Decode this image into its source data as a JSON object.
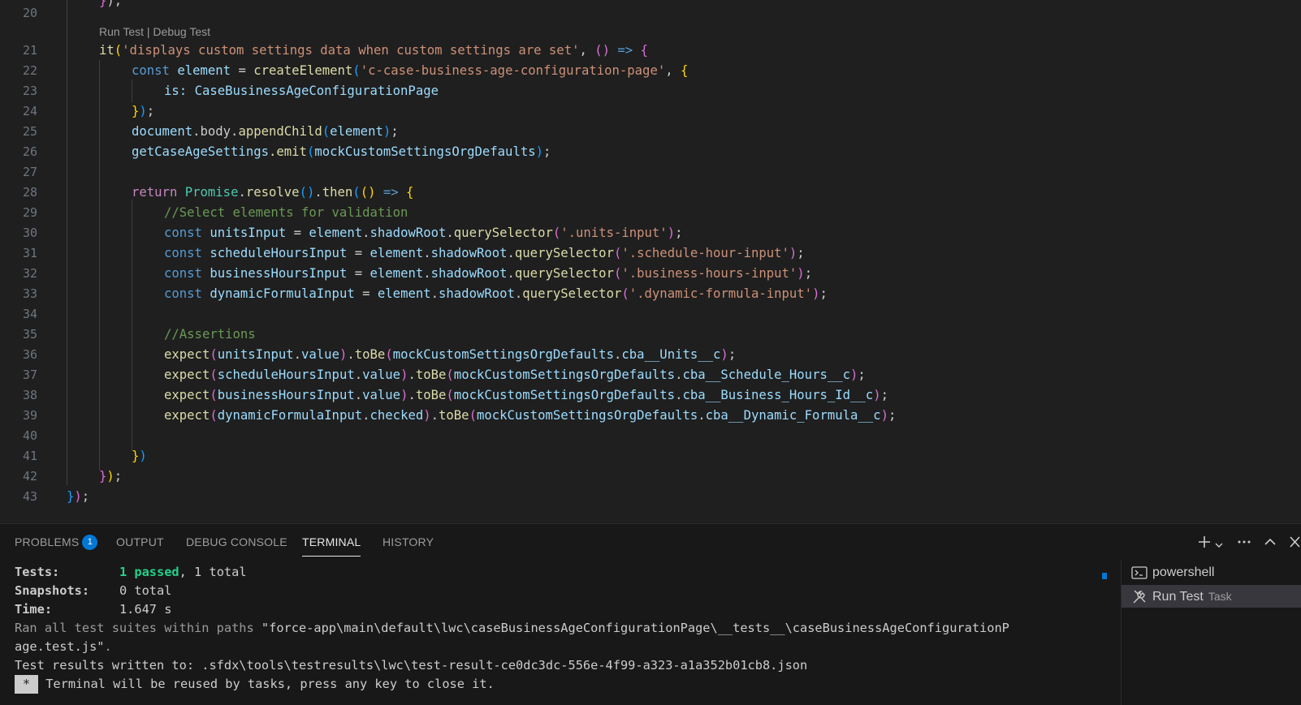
{
  "editor": {
    "codelens": {
      "run": "Run Test",
      "sep": " | ",
      "debug": "Debug Test"
    },
    "lines": [
      {
        "n": "20"
      },
      {
        "n": "21"
      },
      {
        "n": "22"
      },
      {
        "n": "23"
      },
      {
        "n": "24"
      },
      {
        "n": "25"
      },
      {
        "n": "26"
      },
      {
        "n": "27"
      },
      {
        "n": "28"
      },
      {
        "n": "29"
      },
      {
        "n": "30"
      },
      {
        "n": "31"
      },
      {
        "n": "32"
      },
      {
        "n": "33"
      },
      {
        "n": "34"
      },
      {
        "n": "35"
      },
      {
        "n": "36"
      },
      {
        "n": "37"
      },
      {
        "n": "38"
      },
      {
        "n": "39"
      },
      {
        "n": "40"
      },
      {
        "n": "41"
      },
      {
        "n": "42"
      },
      {
        "n": "43"
      }
    ],
    "code": {
      "l21_it": "it",
      "l21_str": "'displays custom settings data when custom settings are set'",
      "l22_const": "const",
      "l22_var": "element",
      "l22_fn": "createElement",
      "l22_str": "'c-case-business-age-configuration-page'",
      "l23_is": "is: ",
      "l23_cls": "CaseBusinessAgeConfigurationPage",
      "l25_a": "document",
      "l25_b": ".body.",
      "l25_fn": "appendChild",
      "l25_arg": "element",
      "l26_a": "getCaseAgeSettings",
      "l26_fn": ".emit",
      "l26_arg": "mockCustomSettingsOrgDefaults",
      "l28_ret": "return",
      "l28_cls": "Promise",
      "l28_fn1": "resolve",
      "l28_fn2": "then",
      "l29_cm": "//Select elements for validation",
      "l30_var": "unitsInput",
      "l30_str": "'.units-input'",
      "l31_var": "scheduleHoursInput",
      "l31_str": "'.schedule-hour-input'",
      "l32_var": "businessHoursInput",
      "l32_str": "'.business-hours-input'",
      "l33_var": "dynamicFormulaInput",
      "l33_str": "'.dynamic-formula-input'",
      "l30_el": "element",
      "l30_sr": "shadowRoot",
      "l30_qs": "querySelector",
      "l35_cm": "//Assertions",
      "expect": "expect",
      "toBe": "toBe",
      "mock": "mockCustomSettingsOrgDefaults",
      "l36_a": "unitsInput",
      "l36_p": "value",
      "l36_f": "cba__Units__c",
      "l37_a": "scheduleHoursInput",
      "l37_p": "value",
      "l37_f": "cba__Schedule_Hours__c",
      "l38_a": "businessHoursInput",
      "l38_p": "value",
      "l38_f": "cba__Business_Hours_Id__c",
      "l39_a": "dynamicFormulaInput",
      "l39_p": "checked",
      "l39_f": "cba__Dynamic_Formula__c"
    }
  },
  "panel": {
    "tabs": [
      {
        "label": "PROBLEMS",
        "badge": "1"
      },
      {
        "label": "OUTPUT"
      },
      {
        "label": "DEBUG CONSOLE"
      },
      {
        "label": "TERMINAL"
      },
      {
        "label": "HISTORY"
      }
    ],
    "terminal": {
      "tests_label": "Tests:",
      "tests_passed": "1 passed",
      "tests_total": ", 1 total",
      "snap_label": "Snapshots:",
      "snap_val": "0 total",
      "time_label": "Time:",
      "time_val": "1.647 s",
      "ran_a": "Ran all test suites within paths ",
      "ran_b": "\"force-app\\main\\default\\lwc\\caseBusinessAgeConfigurationPage\\__tests__\\caseBusinessAgeConfigurationP",
      "ran_c": "age.test.js\"",
      "ran_d": ".",
      "results": "Test results written to: .sfdx\\tools\\testresults\\lwc\\test-result-ce0dc3dc-556e-4f99-a323-a1a352b01cb8.json",
      "reuse_mark": "*",
      "reuse": " Terminal will be reused by tasks, press any key to close it."
    },
    "terminals": [
      {
        "label": "powershell"
      },
      {
        "label": "Run Test",
        "sub": "Task"
      }
    ]
  }
}
